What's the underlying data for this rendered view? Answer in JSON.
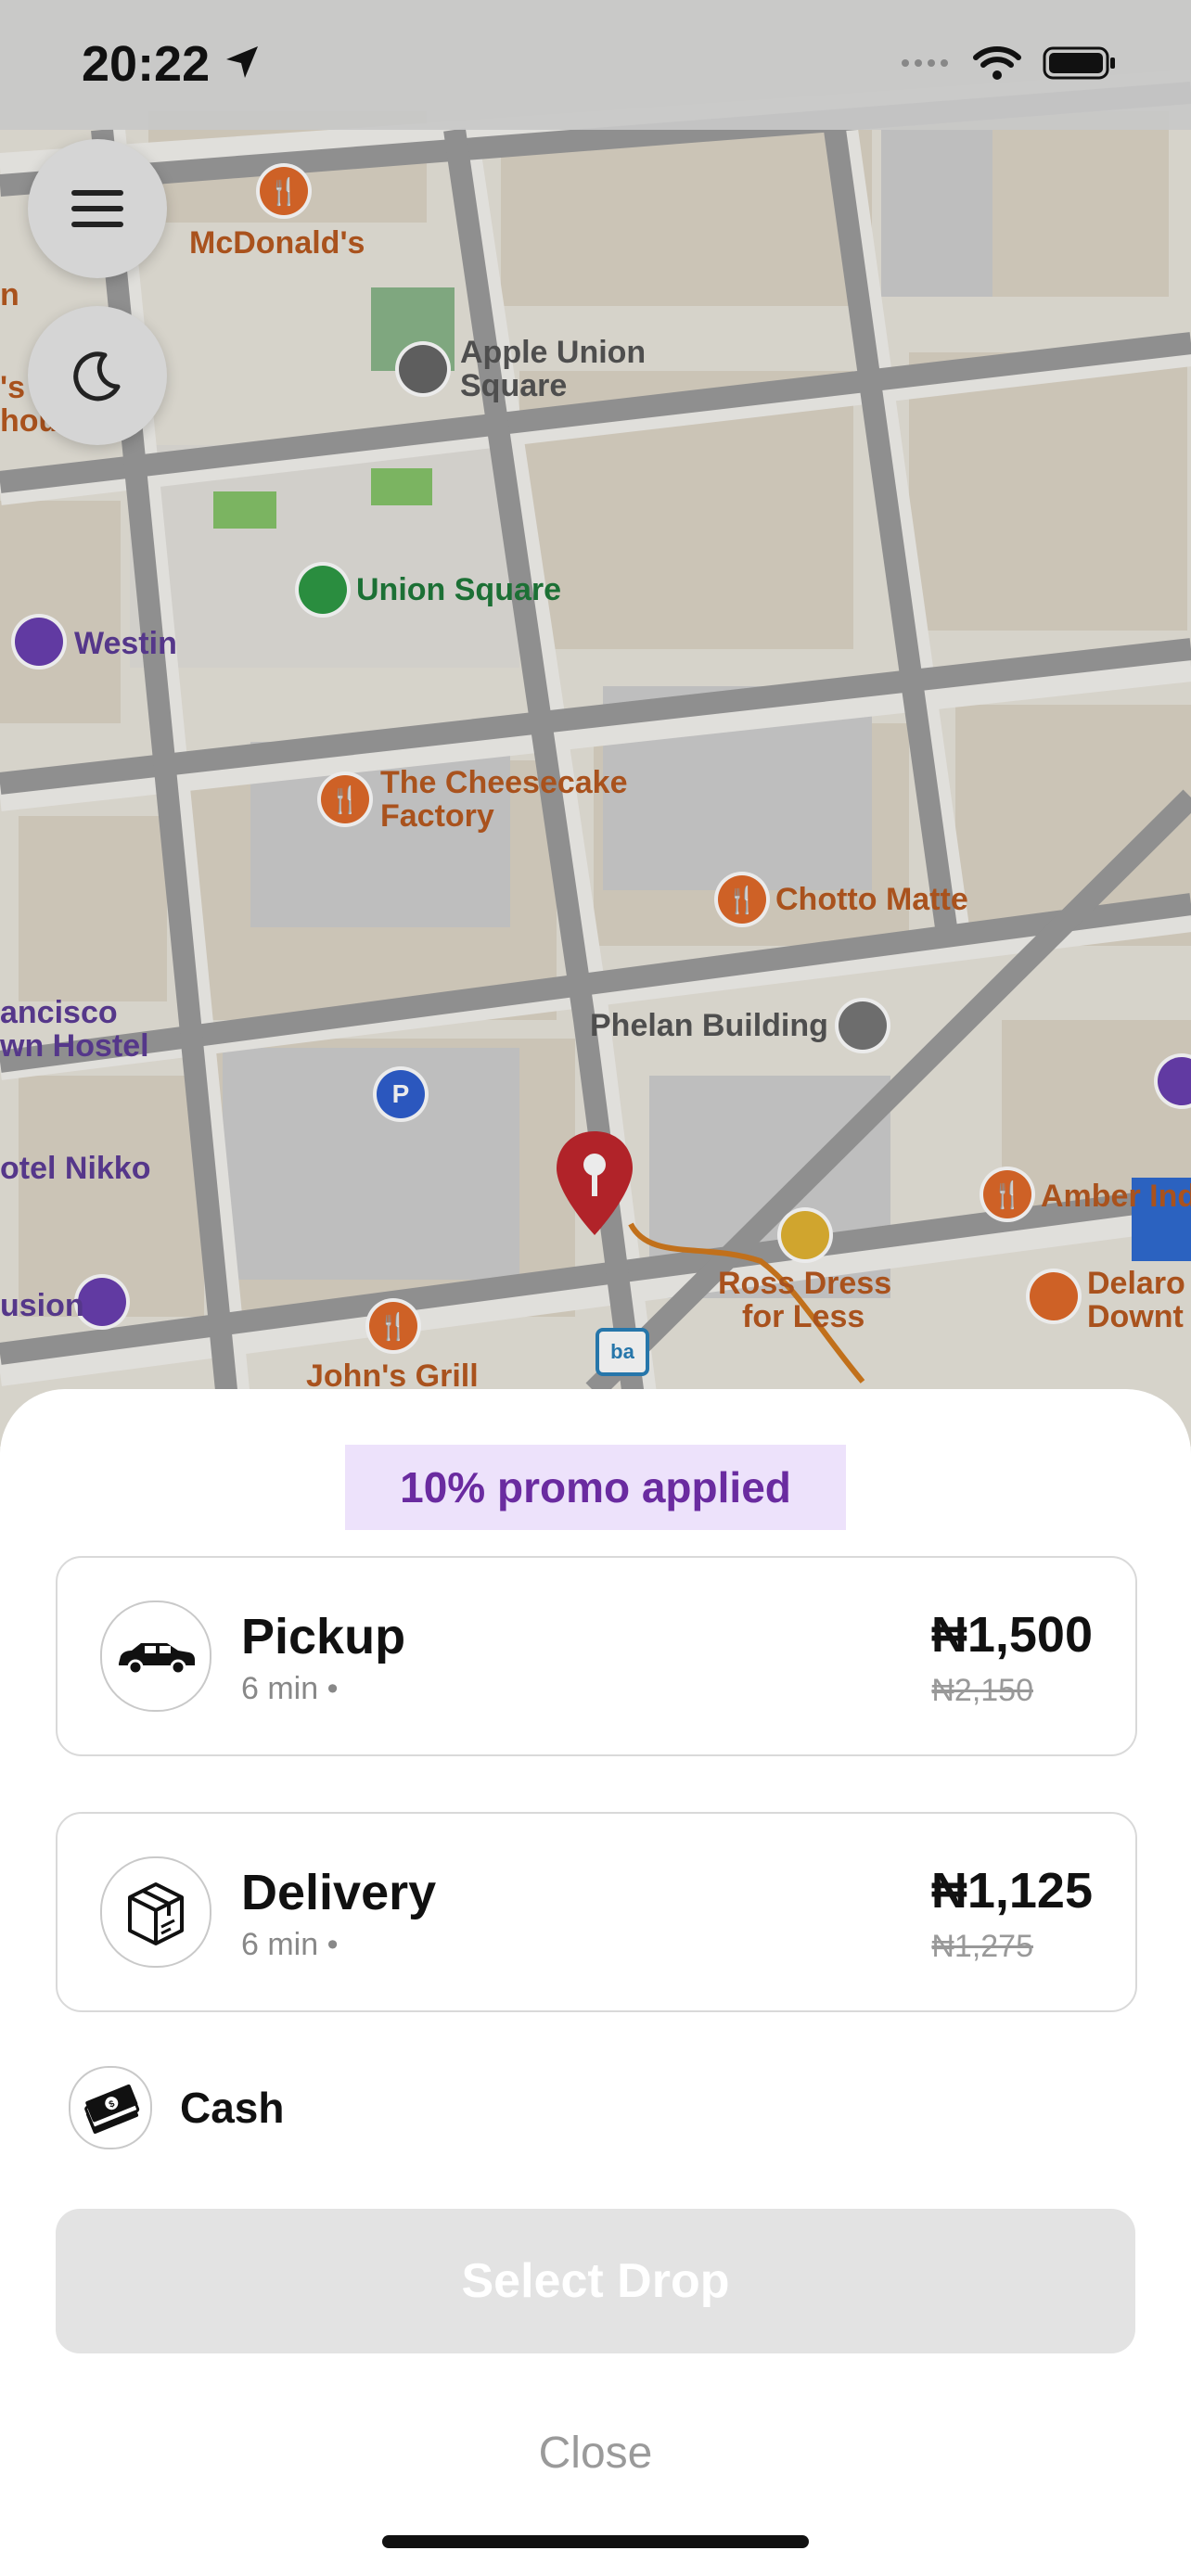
{
  "status_bar": {
    "time": "20:22"
  },
  "map": {
    "labels": {
      "mcdonalds": "McDonald's",
      "apple_union": "Apple Union",
      "apple_square": "Square",
      "union_square": "Union Square",
      "westin": "Westin",
      "cheesecake_1": "The Cheesecake",
      "cheesecake_2": "Factory",
      "chotto": "Chotto Matte",
      "sf_1": "ancisco",
      "sf_2": "wn Hostel",
      "phelan": "Phelan Building",
      "nikko": "otel Nikko",
      "amber": "Amber Ind",
      "ross_1": "Ross Dress",
      "ross_2": "for Less",
      "delarosa_1": "Delaro",
      "delarosa_2": "Downt",
      "fusion": "usion",
      "johns_grill": "John's Grill",
      "s_frag": "'s",
      "hou_frag": "hou",
      "n_frag": "n"
    }
  },
  "sheet": {
    "promo": "10% promo applied",
    "options": [
      {
        "title": "Pickup",
        "subtitle": "6 min •",
        "price": "₦1,500",
        "old_price": "₦2,150",
        "icon": "car-icon"
      },
      {
        "title": "Delivery",
        "subtitle": "6 min •",
        "price": "₦1,125",
        "old_price": "₦1,275",
        "icon": "package-icon"
      }
    ],
    "payment": {
      "label": "Cash",
      "icon": "cash-icon"
    },
    "cta_label": "Select Drop",
    "close_label": "Close"
  },
  "colors": {
    "promo_bg": "#ede2fb",
    "promo_text": "#6a2ba0",
    "pin": "#c0262d",
    "route": "#d27a1e"
  }
}
